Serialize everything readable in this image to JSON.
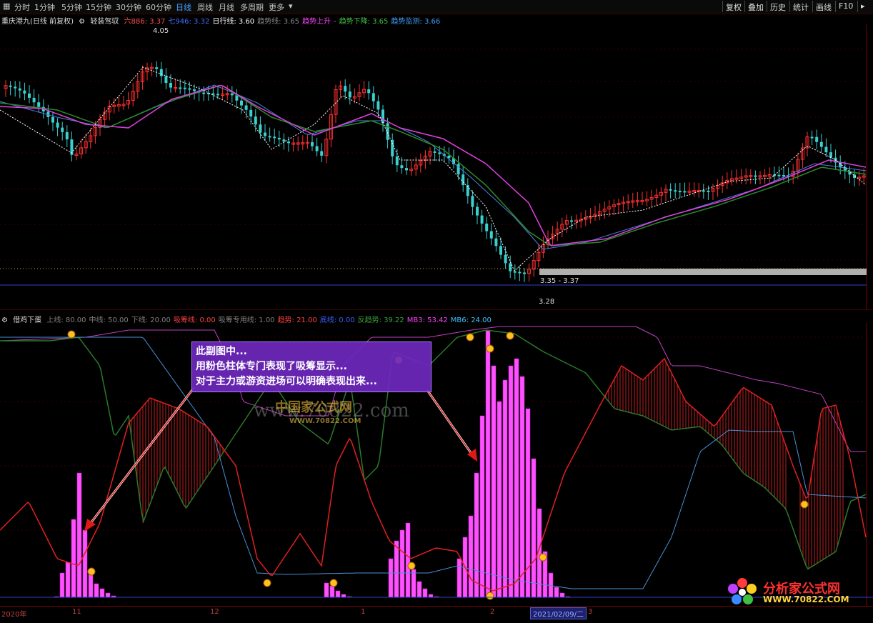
{
  "toolbar": {
    "periods": [
      "分时",
      "1分钟",
      "5分钟",
      "15分钟",
      "30分钟",
      "60分钟",
      "日线",
      "周线",
      "月线",
      "多周期",
      "更多"
    ],
    "active": "日线",
    "right": [
      "复权",
      "叠加",
      "历史",
      "统计",
      "画线",
      "F10"
    ]
  },
  "main_legend": {
    "stock": "重庆港九(日线 前复权)",
    "formula": "轻装驾驭",
    "items": [
      {
        "t": "六886: 3.37",
        "c": "#ff5050"
      },
      {
        "t": "七946: 3.32",
        "c": "#4070ff"
      },
      {
        "t": "日行线: 3.60",
        "c": "#ffffff"
      },
      {
        "t": "趋势线: 3.65",
        "c": "#888888"
      },
      {
        "t": "趋势上升",
        "c": "#ff40ff"
      },
      {
        "t": "-",
        "c": "#ff40ff"
      },
      {
        "t": "趋势下降: 3.65",
        "c": "#40c040"
      },
      {
        "t": "趋势监测: 3.66",
        "c": "#40a0ff"
      }
    ]
  },
  "main_annotations": {
    "high": "4.05",
    "low": "3.28",
    "range": "3.35 - 3.37"
  },
  "sub_legend": {
    "title": "借鸡下蛋",
    "items": [
      {
        "t": "上线: 80.00",
        "c": "#808080"
      },
      {
        "t": "中线: 50.00",
        "c": "#808080"
      },
      {
        "t": "下线: 20.00",
        "c": "#808080"
      },
      {
        "t": "吸筹线: 0.00",
        "c": "#ff4040"
      },
      {
        "t": "吸筹专用线: 1.00",
        "c": "#808080"
      },
      {
        "t": "趋势: 21.00",
        "c": "#ff4040"
      },
      {
        "t": "底线: 0.00",
        "c": "#4060ff"
      },
      {
        "t": "反趋势: 39.22",
        "c": "#40a040"
      },
      {
        "t": "MB3: 53.42",
        "c": "#ff40ff"
      },
      {
        "t": "MB6: 24.00",
        "c": "#40c0ff"
      }
    ]
  },
  "annotation": {
    "lines": [
      "此副图中...",
      "用粉色柱体专门表现了吸筹显示...",
      "对于主力或游资进场可以明确表现出来..."
    ]
  },
  "watermark": {
    "text": "www.70822.com",
    "logo": "中国家公式网",
    "url": "WWW.70822.COM"
  },
  "brand": {
    "name": "分析家公式网",
    "url": "WWW.70822.COM"
  },
  "axis": {
    "labels": [
      "2020年",
      "11",
      "12",
      "1",
      "2",
      "3"
    ],
    "date_box": "2021/02/09/二"
  },
  "colors": {
    "up": "#ff3030",
    "down": "#3ad0d0",
    "pink": "#ff40ff",
    "green": "#40a040",
    "blue": "#4090ff"
  }
}
